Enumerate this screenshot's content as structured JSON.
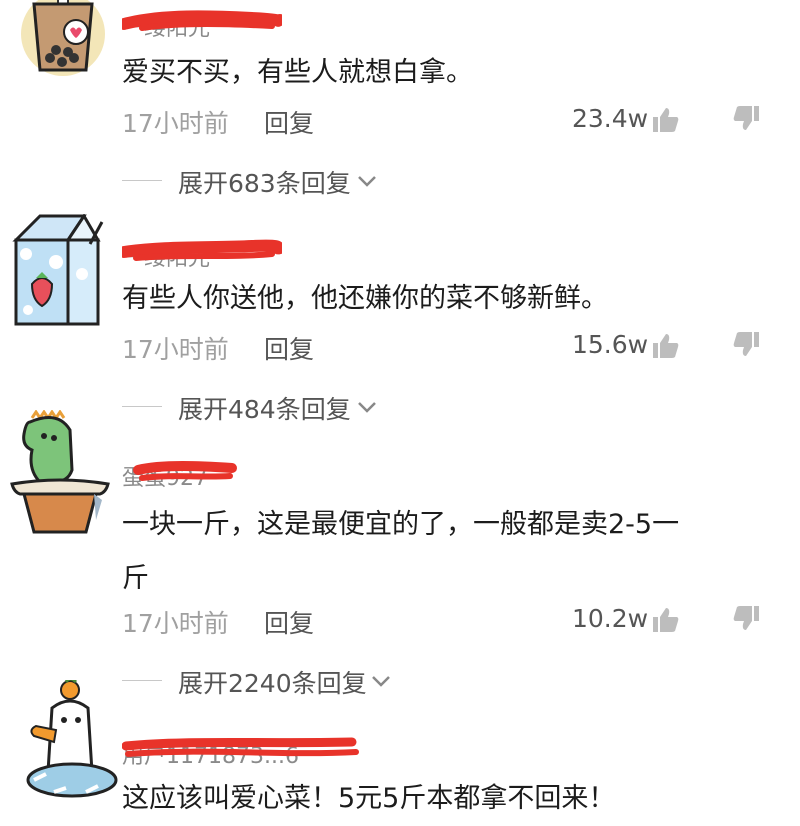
{
  "comments": [
    {
      "username": "一缕阳光",
      "avatar_icon": "bubble-tea-cup-icon",
      "text_lines": [
        "爱买不买，有些人就想白拿。"
      ],
      "time": "17小时前",
      "reply_label": "回复",
      "likes": "23.4w",
      "expand_label": "展开683条回复"
    },
    {
      "username": "一缕阳光",
      "avatar_icon": "milk-carton-icon",
      "text_lines": [
        "有些人你送他，他还嫌你的菜不够新鲜。"
      ],
      "time": "17小时前",
      "reply_label": "回复",
      "likes": "15.6w",
      "expand_label": "展开484条回复"
    },
    {
      "username": "蛋蛋927",
      "avatar_icon": "dinosaur-in-cup-icon",
      "text_lines": [
        "一块一斤，这是最便宜的了，一般都是卖2-5一",
        "斤"
      ],
      "time": "17小时前",
      "reply_label": "回复",
      "likes": "10.2w",
      "expand_label": "展开2240条回复"
    },
    {
      "username": "用户1171873...6",
      "avatar_icon": "duck-with-orange-icon",
      "text_lines": [
        "这应该叫爱心菜！5元5斤本都拿不回来！"
      ]
    }
  ],
  "colors": {
    "redact": "#e8332a",
    "meta_text": "#a0a0a0",
    "action_text": "#555555",
    "content_text": "#1c1c1c"
  }
}
